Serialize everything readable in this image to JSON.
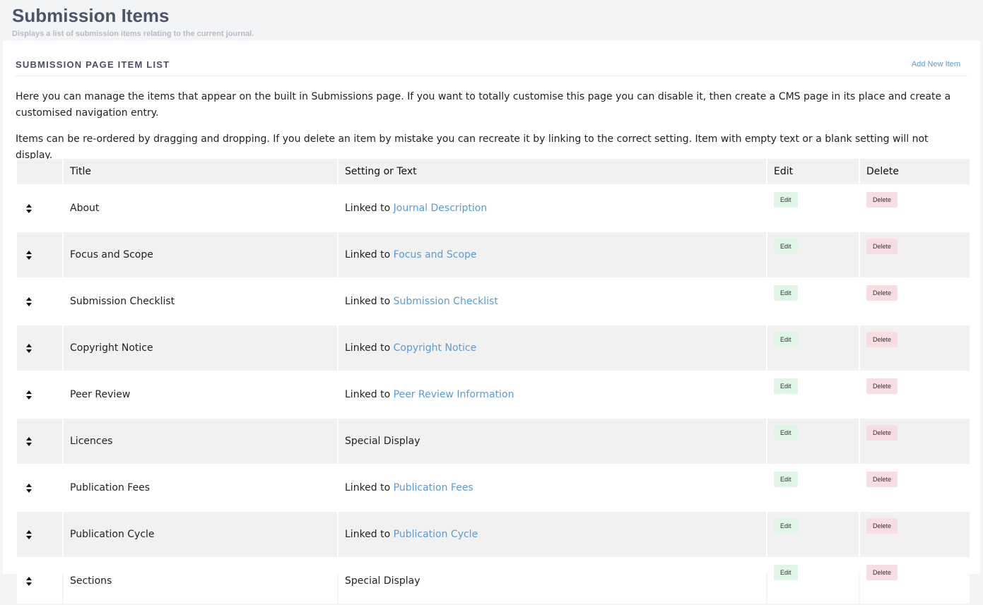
{
  "header": {
    "title": "Submission Items",
    "subtitle": "Displays a list of submission items relating to the current journal."
  },
  "card": {
    "title": "SUBMISSION PAGE ITEM LIST",
    "add_label": "Add New Item",
    "paragraph1": "Here you can manage the items that appear on the built in Submissions page. If you want to totally customise this page you can disable it, then create a CMS page in its place and create a customised navigation entry.",
    "paragraph2": "Items can be re-ordered by dragging and dropping. If you delete an item by mistake you can recreate it by linking to the correct setting. Item with empty text or a blank setting will not display."
  },
  "table": {
    "columns": {
      "title": "Title",
      "setting": "Setting or Text",
      "edit": "Edit",
      "delete": "Delete"
    },
    "edit_label": "Edit",
    "delete_label": "Delete",
    "rows": [
      {
        "title": "About",
        "prefix": "Linked to ",
        "link": "Journal Description"
      },
      {
        "title": "Focus and Scope",
        "prefix": "Linked to ",
        "link": "Focus and Scope"
      },
      {
        "title": "Submission Checklist",
        "prefix": "Linked to ",
        "link": "Submission Checklist"
      },
      {
        "title": "Copyright Notice",
        "prefix": "Linked to ",
        "link": "Copyright Notice"
      },
      {
        "title": "Peer Review",
        "prefix": "Linked to ",
        "link": "Peer Review Information"
      },
      {
        "title": "Licences",
        "prefix": "Special Display",
        "link": ""
      },
      {
        "title": "Publication Fees",
        "prefix": "Linked to ",
        "link": "Publication Fees"
      },
      {
        "title": "Publication Cycle",
        "prefix": "Linked to ",
        "link": "Publication Cycle"
      },
      {
        "title": "Sections",
        "prefix": "Special Display",
        "link": ""
      }
    ]
  }
}
